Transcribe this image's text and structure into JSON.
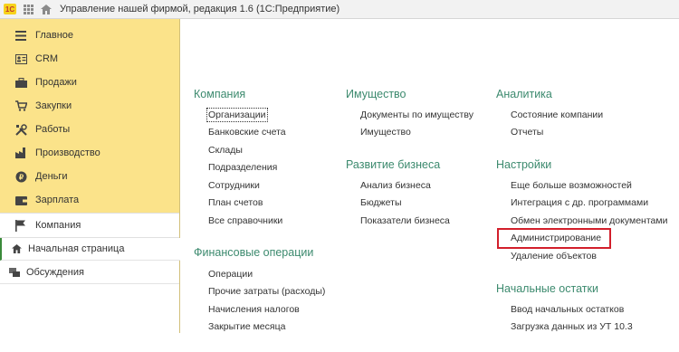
{
  "window": {
    "title": "Управление нашей фирмой, редакция 1.6  (1С:Предприятие)",
    "logo_text": "1С",
    "toolbar_icons": [
      "apps-grid-icon",
      "home-icon"
    ]
  },
  "sidebar": {
    "items": [
      {
        "label": "Главное",
        "icon": "menu-lines-icon"
      },
      {
        "label": "CRM",
        "icon": "contacts-card-icon"
      },
      {
        "label": "Продажи",
        "icon": "briefcase-icon"
      },
      {
        "label": "Закупки",
        "icon": "cart-icon"
      },
      {
        "label": "Работы",
        "icon": "tools-icon"
      },
      {
        "label": "Производство",
        "icon": "factory-icon"
      },
      {
        "label": "Деньги",
        "icon": "coin-icon"
      },
      {
        "label": "Зарплата",
        "icon": "wallet-icon"
      },
      {
        "label": "Компания",
        "icon": "flag-icon"
      }
    ],
    "lower": [
      {
        "label": "Начальная страница",
        "icon": "home-icon"
      },
      {
        "label": "Обсуждения",
        "icon": "chat-icon"
      }
    ]
  },
  "main": {
    "sections": [
      {
        "title": "Компания",
        "links": [
          "Организации",
          "Банковские счета",
          "Склады",
          "Подразделения",
          "Сотрудники",
          "План счетов",
          "Все справочники"
        ]
      },
      {
        "title": "Финансовые операции",
        "links": [
          "Операции",
          "Прочие затраты (расходы)",
          "Начисления налогов",
          "Закрытие месяца"
        ]
      },
      {
        "title": "Имущество",
        "links": [
          "Документы по имуществу",
          "Имущество"
        ]
      },
      {
        "title": "Развитие бизнеса",
        "links": [
          "Анализ бизнеса",
          "Бюджеты",
          "Показатели бизнеса"
        ]
      },
      {
        "title": "Аналитика",
        "links": [
          "Состояние компании",
          "Отчеты"
        ]
      },
      {
        "title": "Настройки",
        "links": [
          "Еще больше возможностей",
          "Интеграция с др. программами",
          "Обмен электронными документами",
          "Администрирование",
          "Удаление объектов"
        ]
      },
      {
        "title": "Начальные остатки",
        "links": [
          "Ввод начальных остатков",
          "Загрузка данных из УТ 10.3"
        ]
      }
    ]
  },
  "colors": {
    "sidebar_bg": "#fbe38a",
    "section_title": "#3c8a6e",
    "highlight": "#d21f2b"
  }
}
